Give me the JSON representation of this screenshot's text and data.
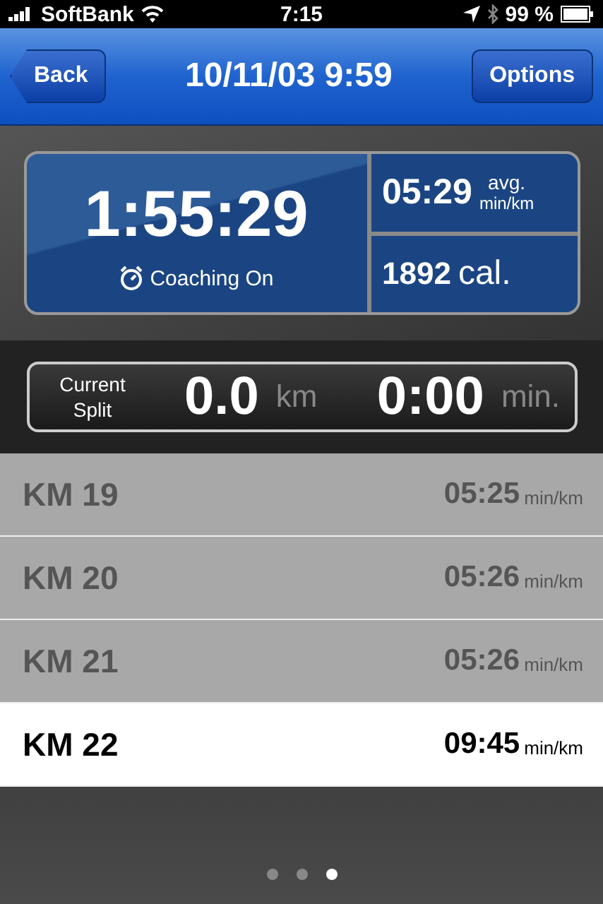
{
  "status_bar": {
    "carrier": "SoftBank",
    "time": "7:15",
    "battery": "99 %"
  },
  "nav": {
    "back": "Back",
    "title": "10/11/03 9:59",
    "options": "Options"
  },
  "stats": {
    "elapsed": "1:55:29",
    "coaching": "Coaching On",
    "pace": "05:29",
    "pace_label": "avg.",
    "pace_unit": "min/km",
    "calories": "1892",
    "calories_unit": "cal."
  },
  "current_split": {
    "label": "Current Split",
    "distance": "0.0",
    "distance_unit": "km",
    "time": "0:00",
    "time_unit": "min."
  },
  "splits": [
    {
      "label": "KM 19",
      "pace": "05:25",
      "unit": "min/km",
      "selected": false
    },
    {
      "label": "KM 20",
      "pace": "05:26",
      "unit": "min/km",
      "selected": false
    },
    {
      "label": "KM 21",
      "pace": "05:26",
      "unit": "min/km",
      "selected": false
    },
    {
      "label": "KM 22",
      "pace": "09:45",
      "unit": "min/km",
      "selected": true
    }
  ],
  "page_dots": [
    {
      "selected": false
    },
    {
      "selected": false
    },
    {
      "selected": true
    }
  ]
}
